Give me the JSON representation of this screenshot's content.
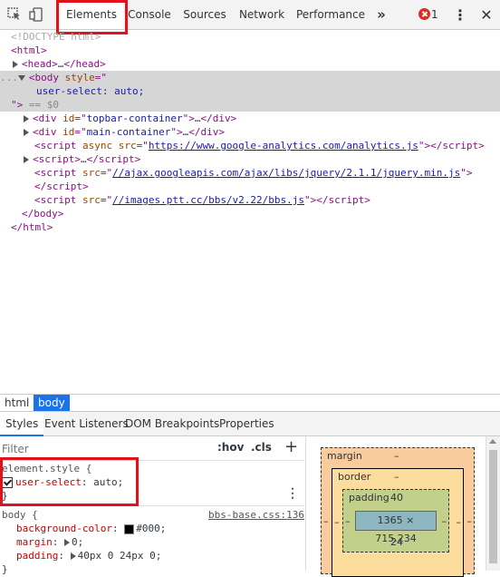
{
  "tabs": {
    "items": [
      "Elements",
      "Console",
      "Sources",
      "Network",
      "Performance"
    ],
    "more": "»",
    "error_count": "1",
    "menu": "⋮"
  },
  "dom": {
    "doctype": "<!DOCTYPE html>",
    "html_open": "<html>",
    "head_open": "<head>",
    "head_ellipsis": "…",
    "head_close": "</head>",
    "body_dots": "...",
    "body_open": "<body",
    "body_attr": "style",
    "body_eq": "=\"",
    "style_value": "user-select: auto;",
    "body_close_attr": "\">",
    "selected_marker": "== $0",
    "div1_id": "topbar-container",
    "div2_id": "main-container",
    "script1_src": "https://www.google-analytics.com/analytics.js",
    "script3_src": "//ajax.googleapis.com/ajax/libs/jquery/2.1.1/jquery.min.js",
    "script4_src": "//images.ptt.cc/bbs/v2.22/bbs.js",
    "body_end": "</body>",
    "html_end": "</html>"
  },
  "breadcrumb": [
    "html",
    "body"
  ],
  "subtabs": [
    "Styles",
    "Event Listeners",
    "DOM Breakpoints",
    "Properties"
  ],
  "filter": {
    "placeholder": "Filter",
    "hov": ":hov",
    "cls": ".cls",
    "add": "+"
  },
  "styles": {
    "element_selector": "element.style {",
    "element_prop": "user-select",
    "element_value": "auto;",
    "close_brace": "}",
    "body_selector": "body {",
    "body_source": "bbs-base.css:136",
    "body_props": [
      {
        "name": "background-color",
        "value": "#000;"
      },
      {
        "name": "margin",
        "value": "0;"
      },
      {
        "name": "padding",
        "value": "40px 0 24px 0;"
      }
    ]
  },
  "box_model": {
    "margin_label": "margin",
    "margin_top": "–",
    "margin_left": "–",
    "margin_right": "–",
    "border_label": "border",
    "border_top": "–",
    "border_left": "–",
    "border_right": "–",
    "padding_label": "padding",
    "padding_top": "40",
    "padding_left": "–",
    "padding_right": "–",
    "padding_bottom": "24",
    "content": "1365 × 715.234"
  },
  "colors": {
    "accent": "#1a73e8",
    "highlight_box": "#e0131d",
    "margin": "#f9cc9d",
    "border": "#fcdd9d",
    "padding": "#c3d08b",
    "content": "#8cb6c0"
  }
}
